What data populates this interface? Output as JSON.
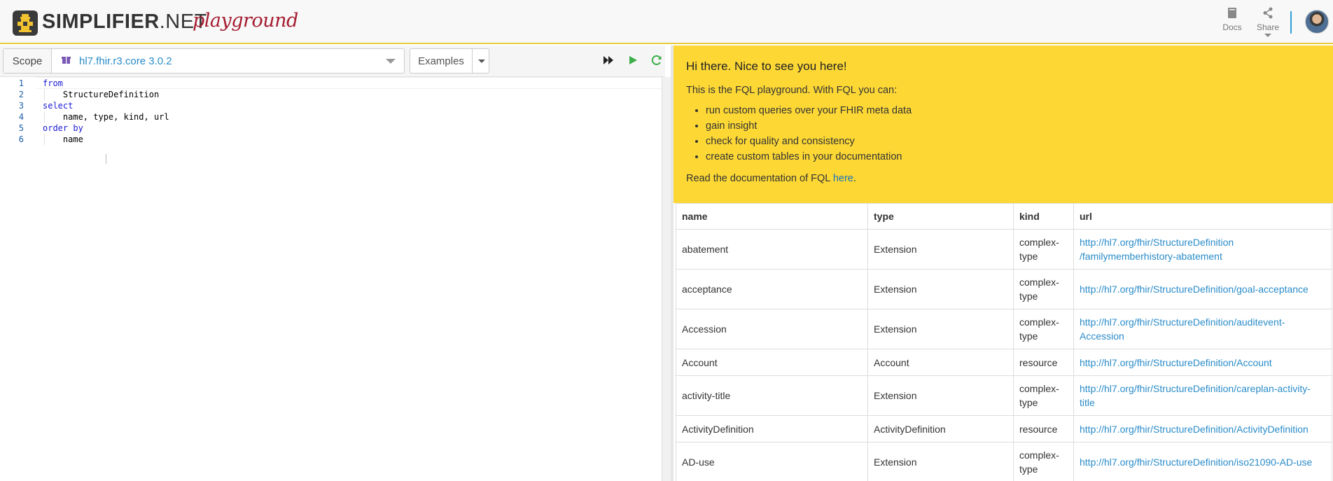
{
  "header": {
    "brand": "SIMPLIFIER",
    "brand_suffix": ".NET",
    "tagline": "playground",
    "docs_label": "Docs",
    "share_label": "Share",
    "accent_color": "#fdd835",
    "link_color": "#2a8cc9"
  },
  "toolbar": {
    "scope_label": "Scope",
    "scope_value": "hl7.fhir.r3.core 3.0.2",
    "examples_label": "Examples"
  },
  "editor": {
    "line_numbers": [
      "1",
      "2",
      "3",
      "4",
      "5",
      "6"
    ],
    "lines": [
      {
        "kw": "from",
        "text": ""
      },
      {
        "kw": "",
        "text": "    StructureDefinition"
      },
      {
        "kw": "select",
        "text": ""
      },
      {
        "kw": "",
        "text": "    name, type, kind, url"
      },
      {
        "kw": "order by",
        "text": ""
      },
      {
        "kw": "",
        "text": "    name"
      }
    ]
  },
  "intro": {
    "greeting": "Hi there. Nice to see you here!",
    "lead": "This is the FQL playground. With FQL you can:",
    "bullets": [
      "run custom queries over your FHIR meta data",
      "gain insight",
      "check for quality and consistency",
      "create custom tables in your documentation"
    ],
    "docs_prefix": "Read the documentation of FQL ",
    "docs_link": "here",
    "docs_suffix": "."
  },
  "results": {
    "columns": [
      "name",
      "type",
      "kind",
      "url"
    ],
    "rows": [
      {
        "name": "abatement",
        "type": "Extension",
        "kind": "complex-type",
        "url": "http://hl7.org/fhir/StructureDefinition/familymemberhistory-abatement",
        "url_line1": "http://hl7.org/fhir/StructureDefinition",
        "url_line2": "/familymemberhistory-abatement"
      },
      {
        "name": "acceptance",
        "type": "Extension",
        "kind": "complex-type",
        "url_line1": "http://hl7.org/fhir/StructureDefinition/goal-acceptance",
        "url_line2": ""
      },
      {
        "name": "Accession",
        "type": "Extension",
        "kind": "complex-type",
        "url_line1": "http://hl7.org/fhir/StructureDefinition/auditevent-",
        "url_line2": "Accession"
      },
      {
        "name": "Account",
        "type": "Account",
        "kind": "resource",
        "url_line1": "http://hl7.org/fhir/StructureDefinition/Account",
        "url_line2": ""
      },
      {
        "name": "activity-title",
        "type": "Extension",
        "kind": "complex-type",
        "url_line1": "http://hl7.org/fhir/StructureDefinition/careplan-activity-",
        "url_line2": "title"
      },
      {
        "name": "ActivityDefinition",
        "type": "ActivityDefinition",
        "kind": "resource",
        "url_line1": "http://hl7.org/fhir/StructureDefinition/ActivityDefinition",
        "url_line2": ""
      },
      {
        "name": "AD-use",
        "type": "Extension",
        "kind": "complex-type",
        "url_line1": "http://hl7.org/fhir/StructureDefinition/iso21090-AD-use",
        "url_line2": ""
      }
    ]
  }
}
